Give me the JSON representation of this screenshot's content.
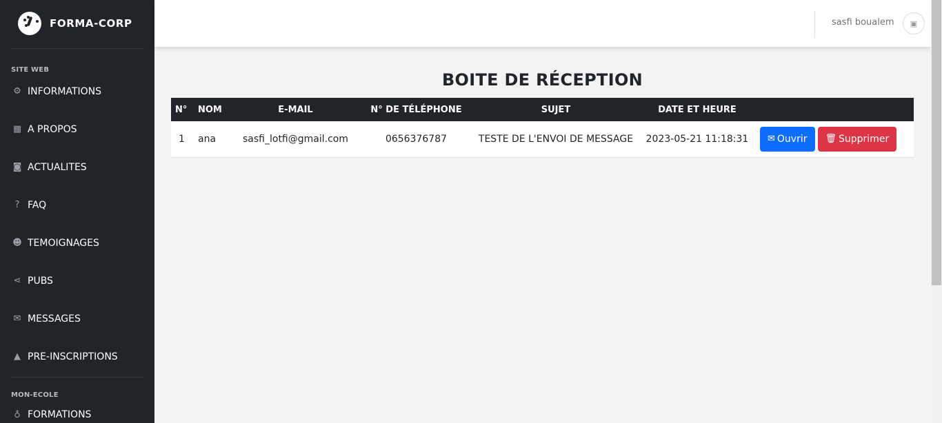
{
  "sidebar": {
    "brand": "FORMA-CORP",
    "section1": "SITE WEB",
    "items": [
      {
        "label": "INFORMATIONS",
        "icon": "gear-icon",
        "glyph": "⚙"
      },
      {
        "label": "A PROPOS",
        "icon": "building-icon",
        "glyph": "▦"
      },
      {
        "label": "ACTUALITES",
        "icon": "camera-icon",
        "glyph": "◙"
      },
      {
        "label": "FAQ",
        "icon": "question-icon",
        "glyph": "?"
      },
      {
        "label": "TEMOIGNAGES",
        "icon": "users-icon",
        "glyph": "☻"
      },
      {
        "label": "PUBS",
        "icon": "share-icon",
        "glyph": "⋖"
      },
      {
        "label": "MESSAGES",
        "icon": "envelope-icon",
        "glyph": "✉"
      },
      {
        "label": "PRE-INSCRIPTIONS",
        "icon": "graduation-cap-icon",
        "glyph": "▲"
      }
    ],
    "section2": "MON-ECOLE",
    "items2": [
      {
        "label": "FORMATIONS",
        "icon": "award-icon",
        "glyph": "♁"
      }
    ]
  },
  "topbar": {
    "user_name": "sasfi boualem"
  },
  "main": {
    "title": "BOITE DE RÉCEPTION",
    "columns": [
      "N°",
      "NOM",
      "E-MAIL",
      "N° DE TÉLÉPHONE",
      "SUJET",
      "DATE ET HEURE",
      ""
    ],
    "rows": [
      {
        "num": "1",
        "nom": "ana",
        "email": "sasfi_lotfi@gmail.com",
        "phone": "0656376787",
        "sujet": "TESTE DE L'ENVOI DE MESSAGE",
        "date": "2023-05-21 11:18:31",
        "open_label": "Ouvrir",
        "delete_label": "Supprimer"
      }
    ]
  },
  "colors": {
    "sidebar_bg": "#212529",
    "primary": "#0d6efd",
    "danger": "#dc3545"
  }
}
